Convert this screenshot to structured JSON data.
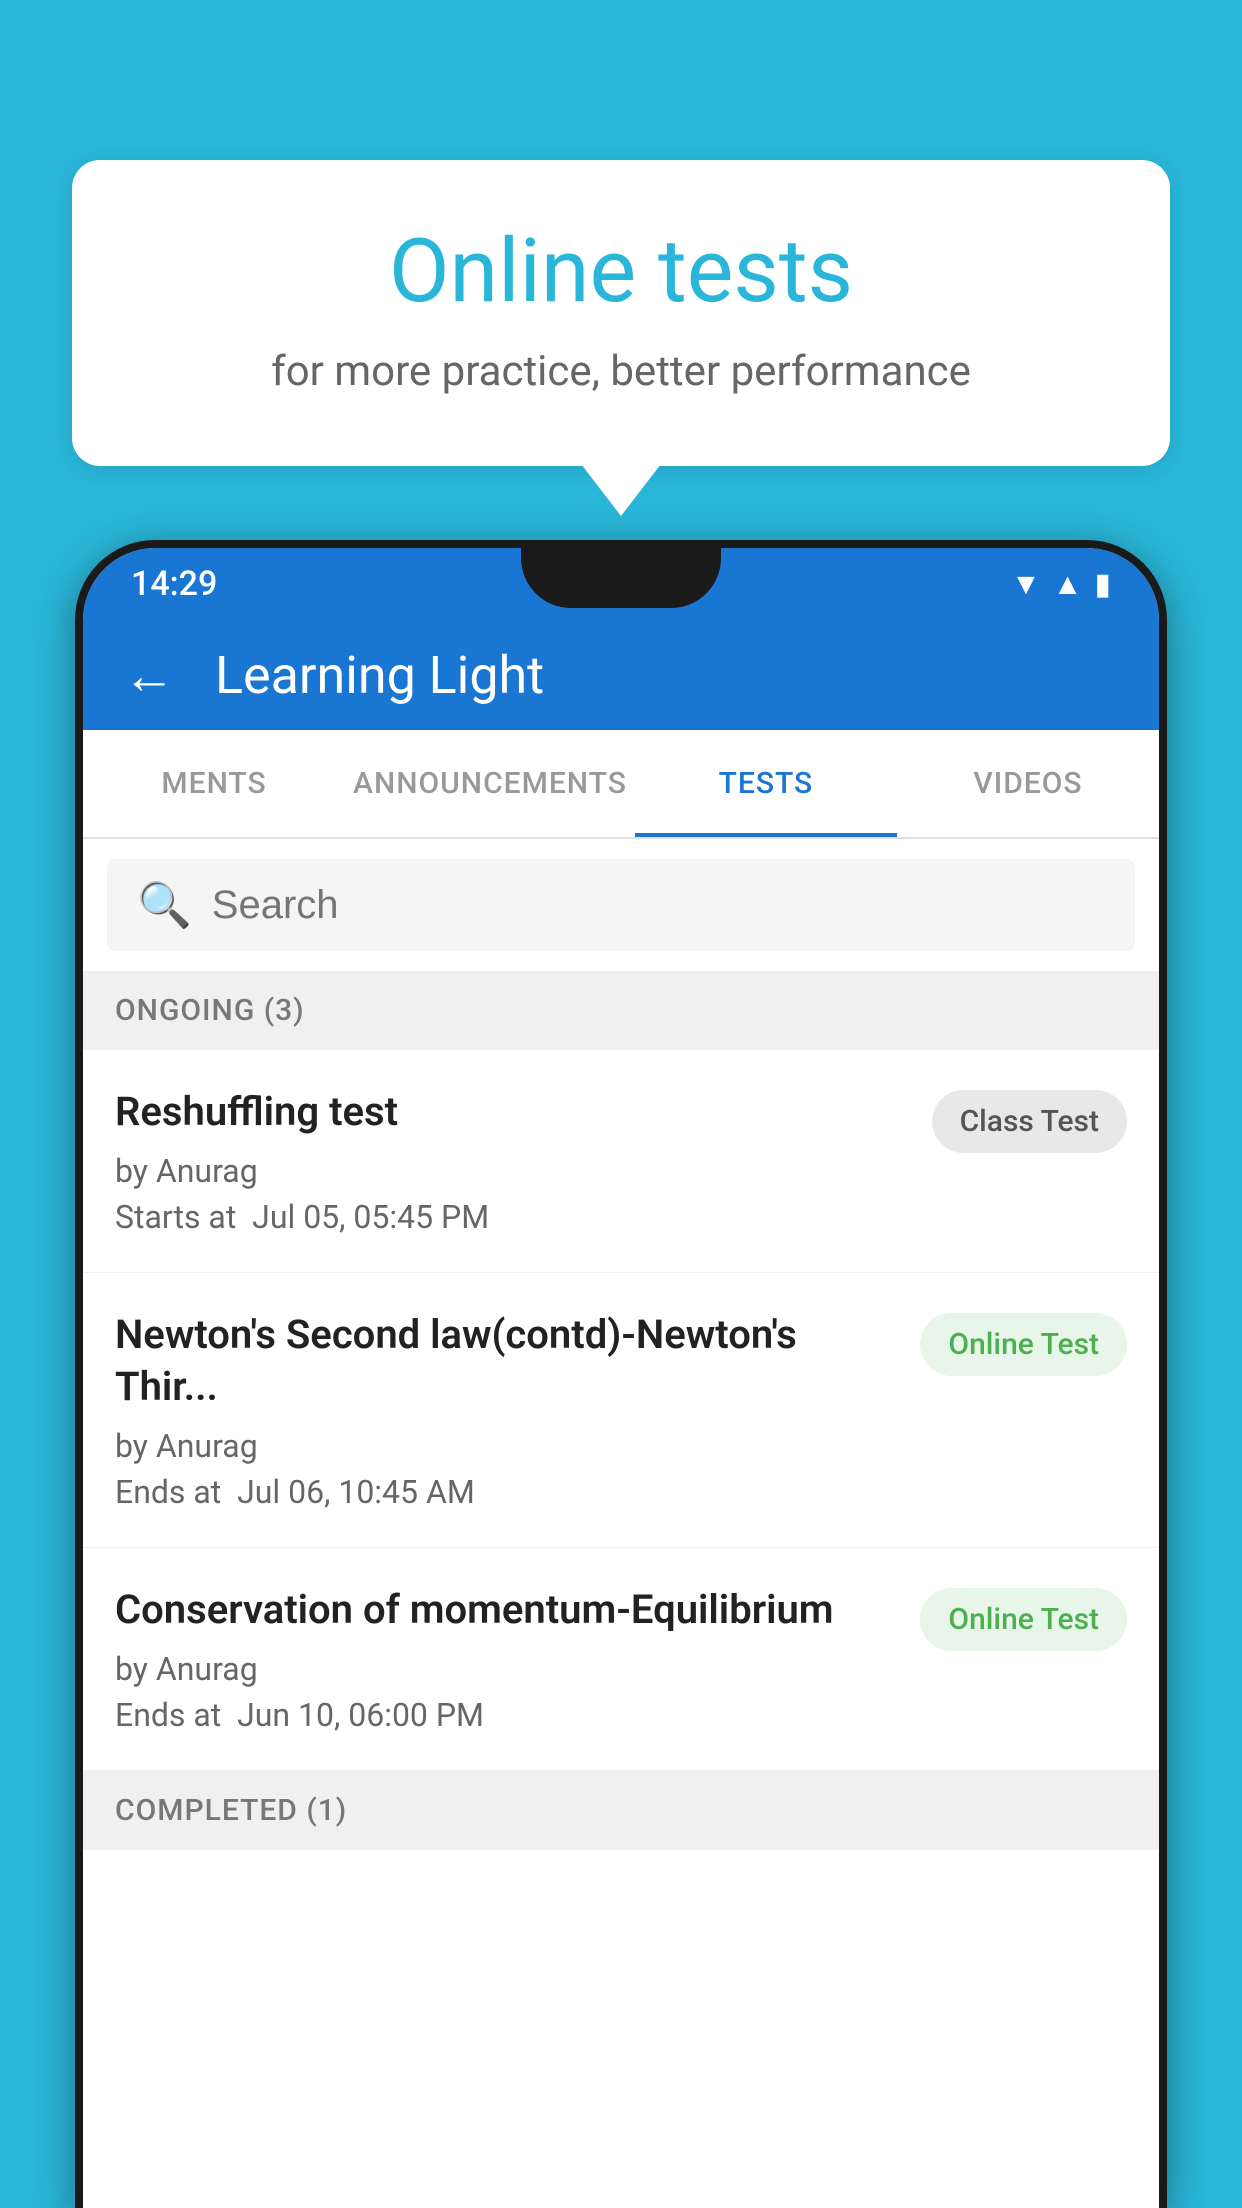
{
  "background_color": "#29b6d8",
  "bubble": {
    "title": "Online tests",
    "subtitle": "for more practice, better performance"
  },
  "status_bar": {
    "time": "14:29",
    "icons": [
      "wifi",
      "signal",
      "battery"
    ]
  },
  "app_bar": {
    "title": "Learning Light",
    "back_label": "←"
  },
  "tabs": [
    {
      "label": "MENTS",
      "active": false
    },
    {
      "label": "ANNOUNCEMENTS",
      "active": false
    },
    {
      "label": "TESTS",
      "active": true
    },
    {
      "label": "VIDEOS",
      "active": false
    }
  ],
  "search": {
    "placeholder": "Search"
  },
  "ongoing_section": {
    "label": "ONGOING (3)"
  },
  "tests": [
    {
      "name": "Reshuffling test",
      "by": "by Anurag",
      "time_label": "Starts at",
      "time": "Jul 05, 05:45 PM",
      "badge": "Class Test",
      "badge_type": "class"
    },
    {
      "name": "Newton's Second law(contd)-Newton's Thir...",
      "by": "by Anurag",
      "time_label": "Ends at",
      "time": "Jul 06, 10:45 AM",
      "badge": "Online Test",
      "badge_type": "online"
    },
    {
      "name": "Conservation of momentum-Equilibrium",
      "by": "by Anurag",
      "time_label": "Ends at",
      "time": "Jun 10, 06:00 PM",
      "badge": "Online Test",
      "badge_type": "online"
    }
  ],
  "completed_section": {
    "label": "COMPLETED (1)"
  }
}
